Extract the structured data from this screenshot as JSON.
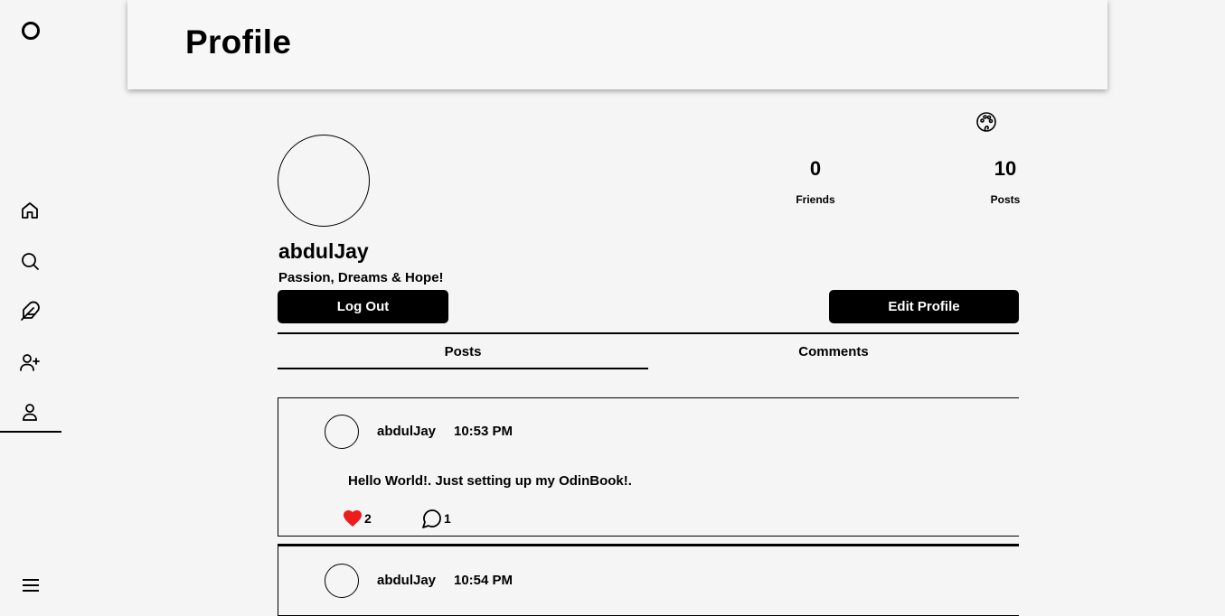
{
  "header": {
    "title": "Profile"
  },
  "sidebar": {
    "items": [
      {
        "name": "home",
        "icon": "home-icon"
      },
      {
        "name": "search",
        "icon": "search-icon"
      },
      {
        "name": "create-post",
        "icon": "feather-icon"
      },
      {
        "name": "add-friend",
        "icon": "user-plus-icon"
      },
      {
        "name": "profile",
        "icon": "user-icon",
        "active": true
      }
    ],
    "menu_icon": "hamburger-menu-icon"
  },
  "profile": {
    "username": "abdulJay",
    "bio": "Passion, Dreams & Hope!",
    "stats": {
      "friends_count": "0",
      "friends_label": "Friends",
      "posts_count": "10",
      "posts_label": "Posts"
    },
    "logout_label": "Log Out",
    "edit_label": "Edit Profile",
    "theme_icon": "palette-icon"
  },
  "tabs": [
    {
      "label": "Posts",
      "active": true
    },
    {
      "label": "Comments",
      "active": false
    }
  ],
  "posts": [
    {
      "user": "abdulJay",
      "time": "10:53 PM",
      "text": "Hello World!. Just setting up my OdinBook!.",
      "likes": "2",
      "comments": "1",
      "liked": true
    },
    {
      "user": "abdulJay",
      "time": "10:54 PM"
    }
  ],
  "colors": {
    "like_red": "#ee1c1c",
    "button_bg": "#000000",
    "page_bg": "#f5f5f5"
  }
}
